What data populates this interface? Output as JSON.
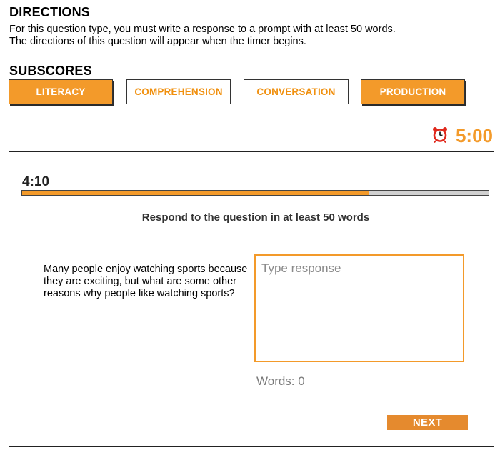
{
  "directions": {
    "heading": "DIRECTIONS",
    "line1": "For this question type, you must write a response to a prompt with at least 50 words.",
    "line2": "The directions of this question will appear when the timer begins."
  },
  "subscores": {
    "heading": "SUBSCORES",
    "buttons": [
      {
        "label": "LITERACY",
        "active": true
      },
      {
        "label": "COMPREHENSION",
        "active": false
      },
      {
        "label": "CONVERSATION",
        "active": false
      },
      {
        "label": "PRODUCTION",
        "active": true
      }
    ]
  },
  "timer": {
    "icon": "alarm-clock-icon",
    "value": "5:00"
  },
  "question": {
    "elapsed": "4:10",
    "progress_fraction": 0.745,
    "instruction": "Respond to the question in at least 50 words",
    "prompt": "Many people enjoy watching sports because they are exciting, but what are some other reasons why people like watching sports?",
    "response_placeholder": "Type response",
    "response_value": "",
    "words_label": "Words:",
    "words_count": "0",
    "next_label": "NEXT"
  },
  "colors": {
    "accent": "#f39a2a",
    "next_button": "#e58a2e",
    "progress_track": "#d0d0d0"
  }
}
